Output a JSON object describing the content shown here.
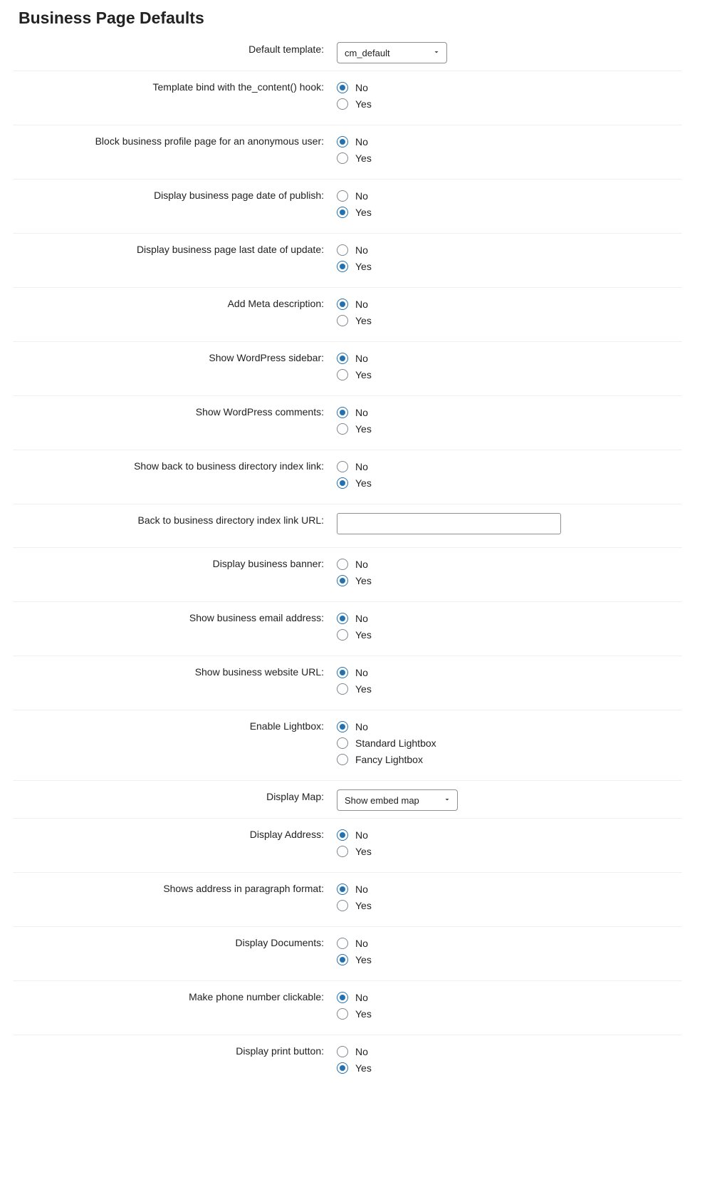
{
  "heading": "Business Page Defaults",
  "common": {
    "no": "No",
    "yes": "Yes"
  },
  "rows": [
    {
      "id": "default-template",
      "label": "Default template:",
      "type": "select",
      "value": "cm_default",
      "width": 155
    },
    {
      "id": "template-bind",
      "label": "Template bind with the_content() hook:",
      "type": "noyes",
      "selected": "no"
    },
    {
      "id": "block-anonymous",
      "label": "Block business profile page for an anonymous user:",
      "type": "noyes",
      "selected": "no"
    },
    {
      "id": "date-of-publish",
      "label": "Display business page date of publish:",
      "type": "noyes",
      "selected": "yes"
    },
    {
      "id": "last-date-update",
      "label": "Display business page last date of update:",
      "type": "noyes",
      "selected": "yes"
    },
    {
      "id": "add-meta",
      "label": "Add Meta description:",
      "type": "noyes",
      "selected": "no"
    },
    {
      "id": "show-wp-sidebar",
      "label": "Show WordPress sidebar:",
      "type": "noyes",
      "selected": "no"
    },
    {
      "id": "show-wp-comments",
      "label": "Show WordPress comments:",
      "type": "noyes",
      "selected": "no"
    },
    {
      "id": "show-back-link",
      "label": "Show back to business directory index link:",
      "type": "noyes",
      "selected": "yes"
    },
    {
      "id": "back-link-url",
      "label": "Back to business directory index link URL:",
      "type": "text",
      "value": ""
    },
    {
      "id": "display-banner",
      "label": "Display business banner:",
      "type": "noyes",
      "selected": "yes"
    },
    {
      "id": "show-email",
      "label": "Show business email address:",
      "type": "noyes",
      "selected": "no"
    },
    {
      "id": "show-website-url",
      "label": "Show business website URL:",
      "type": "noyes",
      "selected": "no"
    },
    {
      "id": "enable-lightbox",
      "label": "Enable Lightbox:",
      "type": "options",
      "selected": 0,
      "options": [
        "No",
        "Standard Lightbox",
        "Fancy Lightbox"
      ]
    },
    {
      "id": "display-map",
      "label": "Display Map:",
      "type": "select",
      "value": "Show embed map",
      "width": 170
    },
    {
      "id": "display-address",
      "label": "Display Address:",
      "type": "noyes",
      "selected": "no"
    },
    {
      "id": "address-paragraph",
      "label": "Shows address in paragraph format:",
      "type": "noyes",
      "selected": "no"
    },
    {
      "id": "display-documents",
      "label": "Display Documents:",
      "type": "noyes",
      "selected": "yes"
    },
    {
      "id": "phone-clickable",
      "label": "Make phone number clickable:",
      "type": "noyes",
      "selected": "no"
    },
    {
      "id": "display-print-button",
      "label": "Display print button:",
      "type": "noyes",
      "selected": "yes"
    }
  ]
}
